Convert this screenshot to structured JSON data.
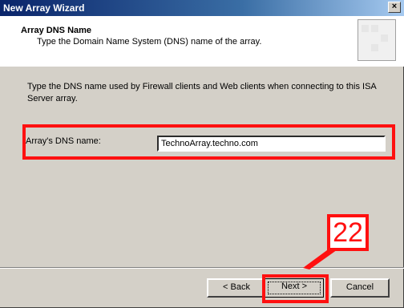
{
  "window": {
    "title": "New Array Wizard",
    "close_glyph": "×"
  },
  "header": {
    "title": "Array DNS Name",
    "subtitle": "Type the Domain Name System (DNS) name of the array."
  },
  "body": {
    "description": "Type the DNS name used by Firewall clients and Web clients when connecting to this ISA Server array.",
    "dns_label": "Array's DNS name:",
    "dns_value": "TechnoArray.techno.com"
  },
  "buttons": {
    "back": "< Back",
    "next": "Next >",
    "cancel": "Cancel"
  },
  "annotation": {
    "step_number": "22",
    "color": "#ff1010"
  }
}
